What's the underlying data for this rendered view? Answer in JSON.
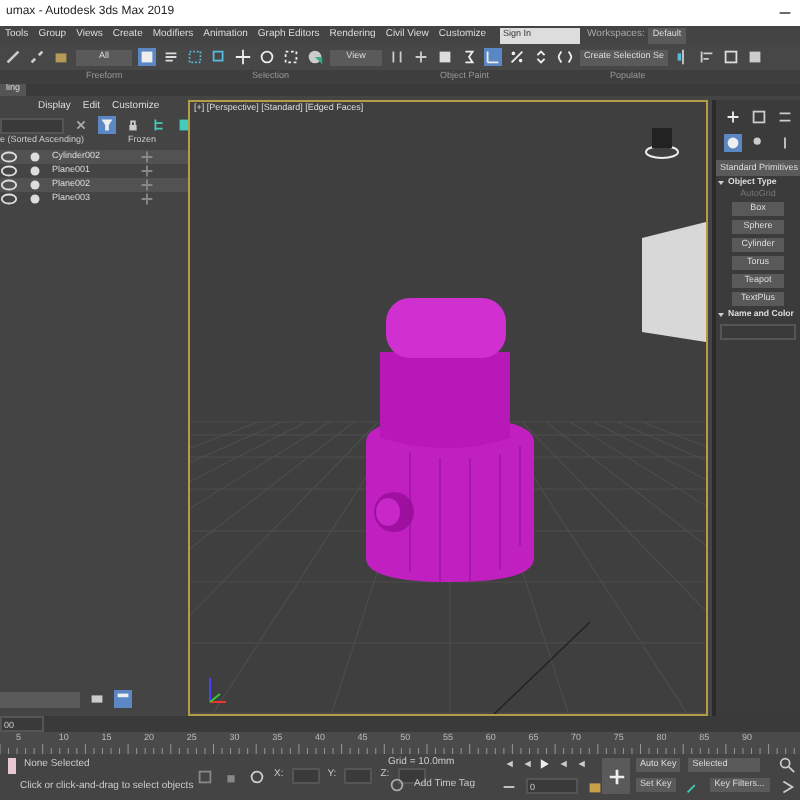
{
  "window": {
    "title": "umax - Autodesk 3ds Max 2019"
  },
  "menu": [
    "Tools",
    "Group",
    "Views",
    "Create",
    "Modifiers",
    "Animation",
    "Graph Editors",
    "Rendering",
    "Civil View",
    "Customize"
  ],
  "sign_in": "Sign In",
  "workspaces_label": "Workspaces:",
  "workspace": "Default",
  "toolbar": {
    "selection_filter": "All",
    "reference_coord": "View",
    "selection_set": "Create Selection Se"
  },
  "ribbon_labels": [
    "Freeform",
    "Selection",
    "Object Paint",
    "Populate"
  ],
  "ribbon_tab": "ling",
  "scene_explorer": {
    "tabs": [
      "Display",
      "Edit",
      "Customize"
    ],
    "columns": [
      "e (Sorted Ascending)",
      "Frozen"
    ],
    "rows": [
      {
        "name": "Cylinder002"
      },
      {
        "name": "Plane001"
      },
      {
        "name": "Plane002"
      },
      {
        "name": "Plane003"
      }
    ]
  },
  "viewport": {
    "label": "[+] [Perspective] [Standard] [Edged Faces]"
  },
  "command_panel": {
    "category": "Standard Primitives",
    "rollouts": [
      {
        "title": "Object Type",
        "expanded": true,
        "autogrid": "AutoGrid",
        "buttons": [
          "Box",
          "Sphere",
          "Cylinder",
          "Torus",
          "Teapot",
          "TextPlus"
        ]
      },
      {
        "title": "Name and Color",
        "expanded": true
      }
    ]
  },
  "timeline": {
    "frame_field": "00",
    "ticks": [
      "5",
      "10",
      "15",
      "20",
      "25",
      "30",
      "35",
      "40",
      "45",
      "50",
      "55",
      "60",
      "65",
      "70",
      "75",
      "80",
      "85",
      "90"
    ]
  },
  "status": {
    "selection": "None Selected",
    "prompt": "Click or click-and-drag to select objects",
    "coords": [
      "X:",
      "Y:",
      "Z:"
    ],
    "grid": "Grid = 10.0mm",
    "add_time_tag": "Add Time Tag"
  },
  "animation": {
    "auto_key": "Auto Key",
    "set_key": "Set Key",
    "key_mode": "Selected",
    "key_filters": "Key Filters...",
    "frame": "0"
  }
}
